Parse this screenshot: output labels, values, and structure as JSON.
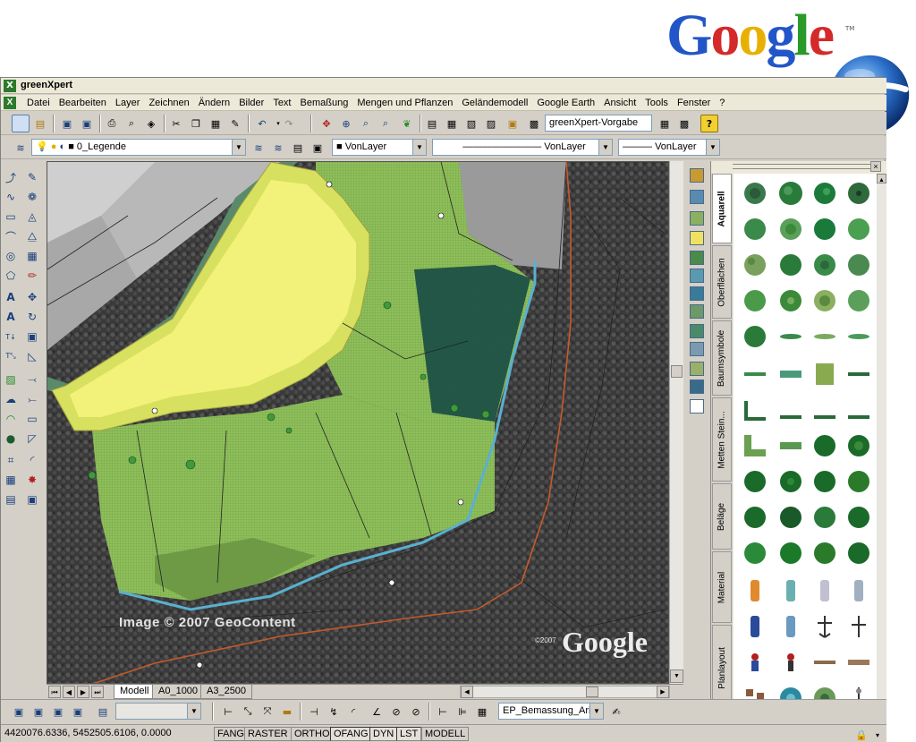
{
  "google": {
    "logo_letters": [
      "G",
      "o",
      "o",
      "g",
      "l",
      "e"
    ],
    "logo_colors": [
      "#2255c8",
      "#d42a2a",
      "#e8b000",
      "#2255c8",
      "#2a9a2a",
      "#d42a2a"
    ],
    "tm": "TM"
  },
  "window": {
    "title": "greenXpert",
    "icon": "greenxpert-logo-icon"
  },
  "menu": [
    "Datei",
    "Bearbeiten",
    "Layer",
    "Zeichnen",
    "Ändern",
    "Bilder",
    "Text",
    "Bemaßung",
    "Mengen und Pflanzen",
    "Geländemodell",
    "Google Earth",
    "Ansicht",
    "Tools",
    "Fenster",
    "?"
  ],
  "toolbar1": {
    "style_combo": "greenXpert-Vorgabe"
  },
  "toolbar2": {
    "layer_combo": "0_Legende",
    "color_combo": "VonLayer",
    "linetype_combo": "VonLayer",
    "lineweight_combo": "VonLayer"
  },
  "map": {
    "watermark_imagery": "Image © 2007 GeoContent",
    "watermark_google": "Google",
    "watermark_year": "©2007"
  },
  "layout_tabs": [
    "Modell",
    "A0_1000",
    "A3_2500"
  ],
  "active_tab": "Modell",
  "palette": {
    "tabs": [
      "Aquarell",
      "Oberflächen",
      "Baumsymbole",
      "Metten Stein...",
      "Beläge",
      "Material",
      "Planlayout"
    ],
    "active_tab": "Aquarell"
  },
  "bottom_toolbar": {
    "dimstyle_combo": "EP_Bemassung_Aria"
  },
  "status": {
    "coordinates": "4420076.6336, 5452505.6106, 0.0000",
    "toggles": [
      "FANG",
      "RASTER",
      "ORTHO",
      "OFANG",
      "DYN",
      "LST",
      "MODELL"
    ],
    "active_toggles": [
      "OFANG",
      "DYN",
      "LST"
    ]
  },
  "colors": {
    "ui_gray": "#d4d0c8",
    "plan_yellow": "#f2f27a",
    "plan_green": "#7cbf4a",
    "forest_dark": "#1f5a4a"
  }
}
